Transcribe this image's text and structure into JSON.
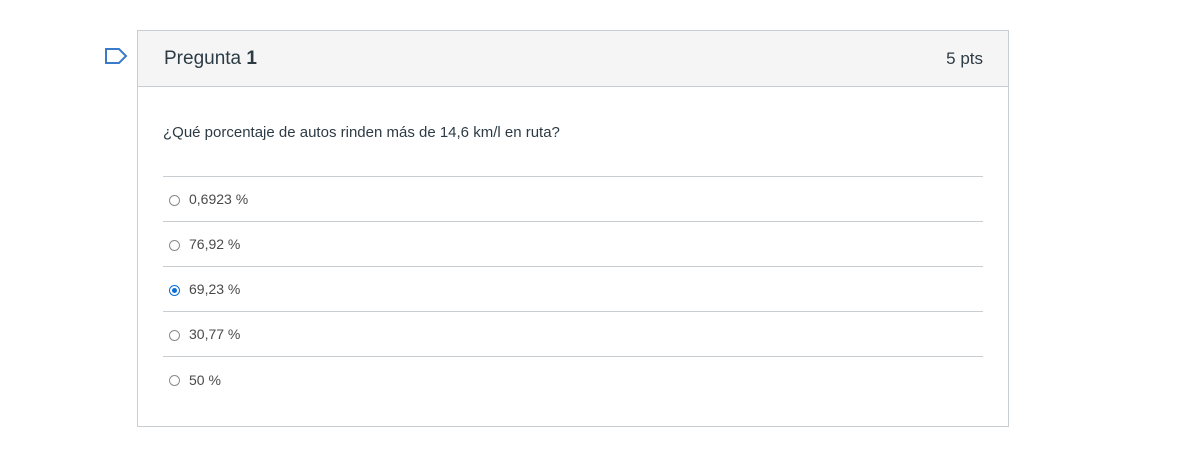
{
  "question": {
    "title_prefix": "Pregunta",
    "number": "1",
    "points": "5 pts",
    "text": "¿Qué porcentaje de autos rinden más de 14,6 km/l en ruta?",
    "flag_icon": "bookmark-flag-icon",
    "answers": [
      {
        "label": "0,6923 %",
        "selected": false
      },
      {
        "label": "76,92 %",
        "selected": false
      },
      {
        "label": "69,23 %",
        "selected": true
      },
      {
        "label": "30,77 %",
        "selected": false
      },
      {
        "label": "50 %",
        "selected": false
      }
    ]
  },
  "colors": {
    "accent": "#0b6ed8",
    "header_bg": "#f5f5f5",
    "border": "#c7cdd1"
  }
}
